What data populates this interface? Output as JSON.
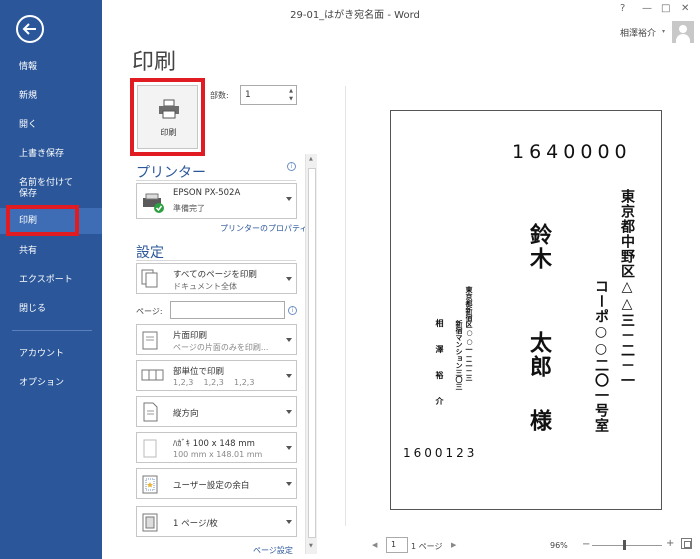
{
  "titlebar": {
    "doc_title": "29-01_はがき宛名面 - Word",
    "help": "?",
    "minimize": "—",
    "restore": "□",
    "close": "✕",
    "user_name": "相澤裕介",
    "user_caret": "▾"
  },
  "nav": {
    "back_icon": "back-arrow-icon",
    "items": [
      {
        "label": "情報"
      },
      {
        "label": "新規"
      },
      {
        "label": "開く"
      },
      {
        "label": "上書き保存"
      },
      {
        "label": "名前を付けて"
      },
      {
        "label": "保存"
      },
      {
        "label": "印刷"
      },
      {
        "label": "共有"
      },
      {
        "label": "エクスポート"
      },
      {
        "label": "閉じる"
      },
      {
        "label": "アカウント"
      },
      {
        "label": "オプション"
      }
    ],
    "active_color": "#3e6db5",
    "bg_color": "#2b579a",
    "highlight_color": "#e01b22"
  },
  "print_pane": {
    "heading": "印刷",
    "print_button": "印刷",
    "copies_label": "部数:",
    "copies_value": "1",
    "printer_title": "プリンター",
    "printer_name": "EPSON PX-502A",
    "printer_status": "準備完了",
    "printer_properties": "プリンターのプロパティ",
    "settings_title": "設定",
    "print_all": {
      "line1": "すべてのページを印刷",
      "line2": "ドキュメント全体"
    },
    "pages_label": "ページ:",
    "pages_value": "",
    "one_sided": {
      "line1": "片面印刷",
      "line2": "ページの片面のみを印刷..."
    },
    "collated": {
      "line1": "部単位で印刷",
      "line2": "1,2,3    1,2,3    1,2,3"
    },
    "orientation": "縦方向",
    "paper": {
      "line1": "ﾊｶﾞｷ 100 x 148 mm",
      "line2": "100 mm x 148.01 mm"
    },
    "margins": "ユーザー設定の余白",
    "pages_per_sheet": "1 ページ/枚",
    "page_setup": "ページ設定"
  },
  "preview": {
    "postal_code": "1640000",
    "recipient_addr1": "東京都中野区△△三－二－一",
    "recipient_addr2": "コーポ○○二〇一号室",
    "recipient_name_family": "鈴木",
    "recipient_name_given": "太郎",
    "honorific": "様",
    "sender_addr1": "東京都新宿区○○一－二－三",
    "sender_addr2": "新宿マンション三〇三",
    "sender_name": "相澤裕介",
    "sender_postal": "1600123"
  },
  "statusbar": {
    "prev": "◀",
    "page_current": "1",
    "page_total": "1 ページ",
    "next": "▶",
    "zoom": "96%",
    "zoom_minus": "−",
    "zoom_plus": "+",
    "zoom_level_percent": 96
  }
}
